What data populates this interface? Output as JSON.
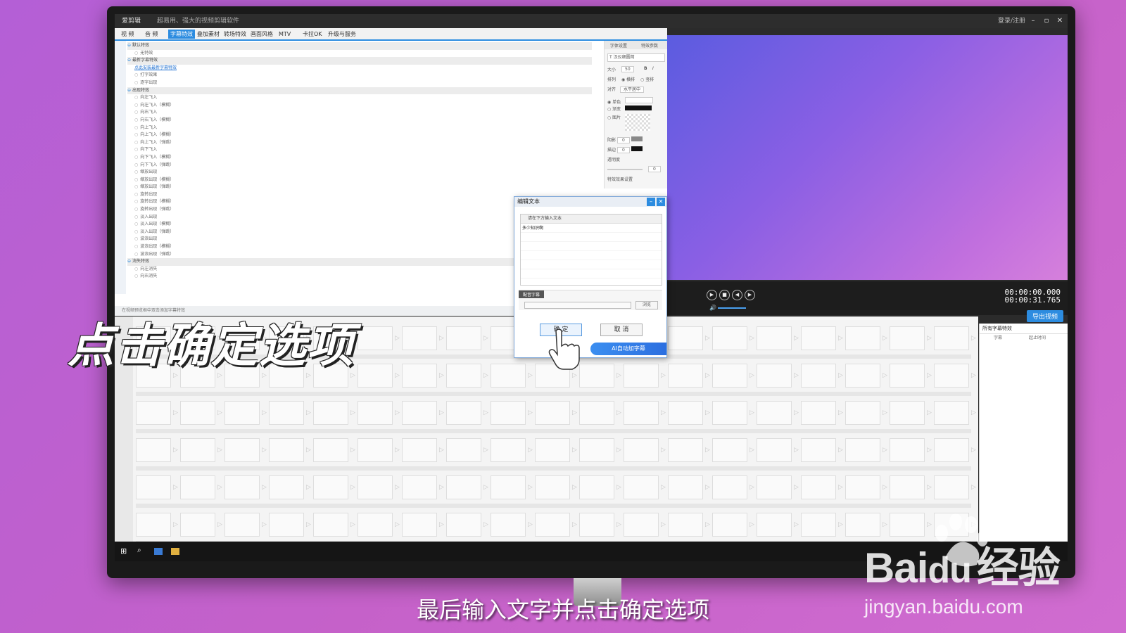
{
  "app": {
    "title": "爱剪辑",
    "slogan": "超易用、强大的视频剪辑软件",
    "user": "登录/注册",
    "window_controls": [
      "–",
      "▫",
      "✕"
    ]
  },
  "tabs": [
    {
      "label": "视 频"
    },
    {
      "label": "音 频"
    },
    {
      "label": "字幕特效",
      "active": true
    },
    {
      "label": "叠加素材"
    },
    {
      "label": "转场特效"
    },
    {
      "label": "画面风格"
    },
    {
      "label": "MTV"
    },
    {
      "label": "卡拉OK"
    },
    {
      "label": "升级与服务"
    }
  ],
  "tree": [
    {
      "type": "cat",
      "label": "默认特效"
    },
    {
      "type": "item",
      "label": "无特效"
    },
    {
      "type": "cat",
      "label": "最新字幕特效"
    },
    {
      "type": "link",
      "label": "点此安装最新字幕特效"
    },
    {
      "type": "item",
      "label": "打字效果"
    },
    {
      "type": "item",
      "label": "逐字出现"
    },
    {
      "type": "cat",
      "label": "出现特效"
    },
    {
      "type": "item",
      "label": "向左飞入"
    },
    {
      "type": "item",
      "label": "向左飞入（模糊）"
    },
    {
      "type": "item",
      "label": "向右飞入"
    },
    {
      "type": "item",
      "label": "向右飞入（模糊）"
    },
    {
      "type": "item",
      "label": "向上飞入"
    },
    {
      "type": "item",
      "label": "向上飞入（模糊）"
    },
    {
      "type": "item",
      "label": "向上飞入（弹跳）"
    },
    {
      "type": "item",
      "label": "向下飞入"
    },
    {
      "type": "item",
      "label": "向下飞入（模糊）"
    },
    {
      "type": "item",
      "label": "向下飞入（弹跳）"
    },
    {
      "type": "item",
      "label": "缩放出现"
    },
    {
      "type": "item",
      "label": "缩放出现（模糊）"
    },
    {
      "type": "item",
      "label": "缩放出现（弹跳）"
    },
    {
      "type": "item",
      "label": "旋转出现"
    },
    {
      "type": "item",
      "label": "旋转出现（模糊）"
    },
    {
      "type": "item",
      "label": "旋转出现（弹跳）"
    },
    {
      "type": "item",
      "label": "淡入出现"
    },
    {
      "type": "item",
      "label": "淡入出现（模糊）"
    },
    {
      "type": "item",
      "label": "淡入出现（弹跳）"
    },
    {
      "type": "item",
      "label": "波浪出现"
    },
    {
      "type": "item",
      "label": "波浪出现（模糊）"
    },
    {
      "type": "item",
      "label": "波浪出现（弹跳）"
    },
    {
      "type": "cat",
      "label": "消失特效"
    },
    {
      "type": "item",
      "label": "向左消失"
    },
    {
      "type": "item",
      "label": "向右消失"
    }
  ],
  "props": {
    "tabs": [
      "字体设置",
      "特效参数"
    ],
    "font": "T 汉仪细圆简",
    "size_label": "大小",
    "size_value": "50",
    "layout_label": "排列",
    "layout_options": [
      "横排",
      "竖排"
    ],
    "align_label": "对齐",
    "align_value": "水平居中",
    "color_options": [
      "单色",
      "渐变",
      "图片"
    ],
    "shadow_label": "阴影",
    "shadow_value": "0",
    "stroke_label": "描边",
    "stroke_value": "0",
    "opacity_label": "透明度",
    "opacity_value": "0",
    "effect_label": "特效效果设置"
  },
  "status_text": "在视频预览框中双击添加字幕特效",
  "player": {
    "time_current": "00:00:00.000",
    "time_total": "00:00:31.765",
    "export_label": "导出视频"
  },
  "right_panel": {
    "title": "所有字幕特效",
    "columns": [
      "字幕",
      "起止时间"
    ]
  },
  "dialog": {
    "title": "编辑文本",
    "hint": "请在下方输入文本",
    "content": "多少知识啊",
    "subtitle_label": "配音字幕",
    "browse_label": "浏览",
    "ok_label": "确 定",
    "cancel_label": "取 消",
    "ai_label": "AI自动加字幕"
  },
  "overlay": {
    "title": "点击确定选项",
    "caption": "最后输入文字并点击确定选项"
  },
  "watermark": {
    "brand": "Bai",
    "brand2": "经验",
    "url": "jingyan.baidu.com"
  },
  "colors": {
    "accent": "#2c8ce0",
    "background": "#c561c9"
  }
}
